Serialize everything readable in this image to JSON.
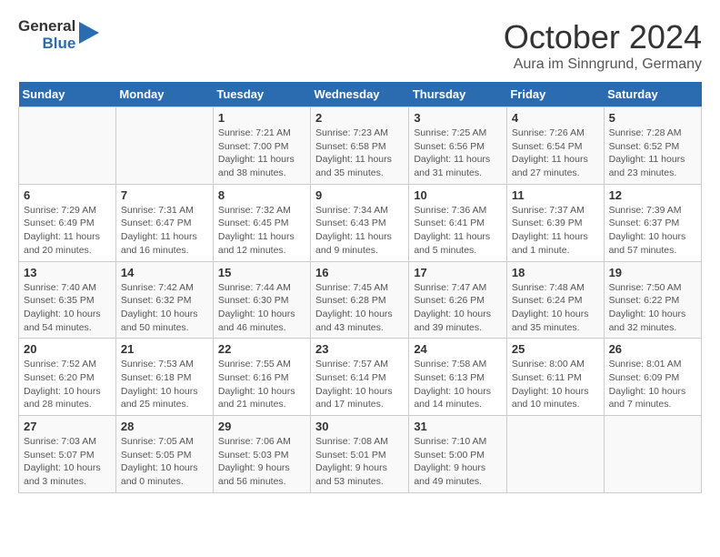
{
  "header": {
    "logo_general": "General",
    "logo_blue": "Blue",
    "month": "October 2024",
    "location": "Aura im Sinngrund, Germany"
  },
  "weekdays": [
    "Sunday",
    "Monday",
    "Tuesday",
    "Wednesday",
    "Thursday",
    "Friday",
    "Saturday"
  ],
  "weeks": [
    [
      {
        "day": null,
        "info": null
      },
      {
        "day": null,
        "info": null
      },
      {
        "day": "1",
        "info": "Sunrise: 7:21 AM\nSunset: 7:00 PM\nDaylight: 11 hours and 38 minutes."
      },
      {
        "day": "2",
        "info": "Sunrise: 7:23 AM\nSunset: 6:58 PM\nDaylight: 11 hours and 35 minutes."
      },
      {
        "day": "3",
        "info": "Sunrise: 7:25 AM\nSunset: 6:56 PM\nDaylight: 11 hours and 31 minutes."
      },
      {
        "day": "4",
        "info": "Sunrise: 7:26 AM\nSunset: 6:54 PM\nDaylight: 11 hours and 27 minutes."
      },
      {
        "day": "5",
        "info": "Sunrise: 7:28 AM\nSunset: 6:52 PM\nDaylight: 11 hours and 23 minutes."
      }
    ],
    [
      {
        "day": "6",
        "info": "Sunrise: 7:29 AM\nSunset: 6:49 PM\nDaylight: 11 hours and 20 minutes."
      },
      {
        "day": "7",
        "info": "Sunrise: 7:31 AM\nSunset: 6:47 PM\nDaylight: 11 hours and 16 minutes."
      },
      {
        "day": "8",
        "info": "Sunrise: 7:32 AM\nSunset: 6:45 PM\nDaylight: 11 hours and 12 minutes."
      },
      {
        "day": "9",
        "info": "Sunrise: 7:34 AM\nSunset: 6:43 PM\nDaylight: 11 hours and 9 minutes."
      },
      {
        "day": "10",
        "info": "Sunrise: 7:36 AM\nSunset: 6:41 PM\nDaylight: 11 hours and 5 minutes."
      },
      {
        "day": "11",
        "info": "Sunrise: 7:37 AM\nSunset: 6:39 PM\nDaylight: 11 hours and 1 minute."
      },
      {
        "day": "12",
        "info": "Sunrise: 7:39 AM\nSunset: 6:37 PM\nDaylight: 10 hours and 57 minutes."
      }
    ],
    [
      {
        "day": "13",
        "info": "Sunrise: 7:40 AM\nSunset: 6:35 PM\nDaylight: 10 hours and 54 minutes."
      },
      {
        "day": "14",
        "info": "Sunrise: 7:42 AM\nSunset: 6:32 PM\nDaylight: 10 hours and 50 minutes."
      },
      {
        "day": "15",
        "info": "Sunrise: 7:44 AM\nSunset: 6:30 PM\nDaylight: 10 hours and 46 minutes."
      },
      {
        "day": "16",
        "info": "Sunrise: 7:45 AM\nSunset: 6:28 PM\nDaylight: 10 hours and 43 minutes."
      },
      {
        "day": "17",
        "info": "Sunrise: 7:47 AM\nSunset: 6:26 PM\nDaylight: 10 hours and 39 minutes."
      },
      {
        "day": "18",
        "info": "Sunrise: 7:48 AM\nSunset: 6:24 PM\nDaylight: 10 hours and 35 minutes."
      },
      {
        "day": "19",
        "info": "Sunrise: 7:50 AM\nSunset: 6:22 PM\nDaylight: 10 hours and 32 minutes."
      }
    ],
    [
      {
        "day": "20",
        "info": "Sunrise: 7:52 AM\nSunset: 6:20 PM\nDaylight: 10 hours and 28 minutes."
      },
      {
        "day": "21",
        "info": "Sunrise: 7:53 AM\nSunset: 6:18 PM\nDaylight: 10 hours and 25 minutes."
      },
      {
        "day": "22",
        "info": "Sunrise: 7:55 AM\nSunset: 6:16 PM\nDaylight: 10 hours and 21 minutes."
      },
      {
        "day": "23",
        "info": "Sunrise: 7:57 AM\nSunset: 6:14 PM\nDaylight: 10 hours and 17 minutes."
      },
      {
        "day": "24",
        "info": "Sunrise: 7:58 AM\nSunset: 6:13 PM\nDaylight: 10 hours and 14 minutes."
      },
      {
        "day": "25",
        "info": "Sunrise: 8:00 AM\nSunset: 6:11 PM\nDaylight: 10 hours and 10 minutes."
      },
      {
        "day": "26",
        "info": "Sunrise: 8:01 AM\nSunset: 6:09 PM\nDaylight: 10 hours and 7 minutes."
      }
    ],
    [
      {
        "day": "27",
        "info": "Sunrise: 7:03 AM\nSunset: 5:07 PM\nDaylight: 10 hours and 3 minutes."
      },
      {
        "day": "28",
        "info": "Sunrise: 7:05 AM\nSunset: 5:05 PM\nDaylight: 10 hours and 0 minutes."
      },
      {
        "day": "29",
        "info": "Sunrise: 7:06 AM\nSunset: 5:03 PM\nDaylight: 9 hours and 56 minutes."
      },
      {
        "day": "30",
        "info": "Sunrise: 7:08 AM\nSunset: 5:01 PM\nDaylight: 9 hours and 53 minutes."
      },
      {
        "day": "31",
        "info": "Sunrise: 7:10 AM\nSunset: 5:00 PM\nDaylight: 9 hours and 49 minutes."
      },
      {
        "day": null,
        "info": null
      },
      {
        "day": null,
        "info": null
      }
    ]
  ]
}
